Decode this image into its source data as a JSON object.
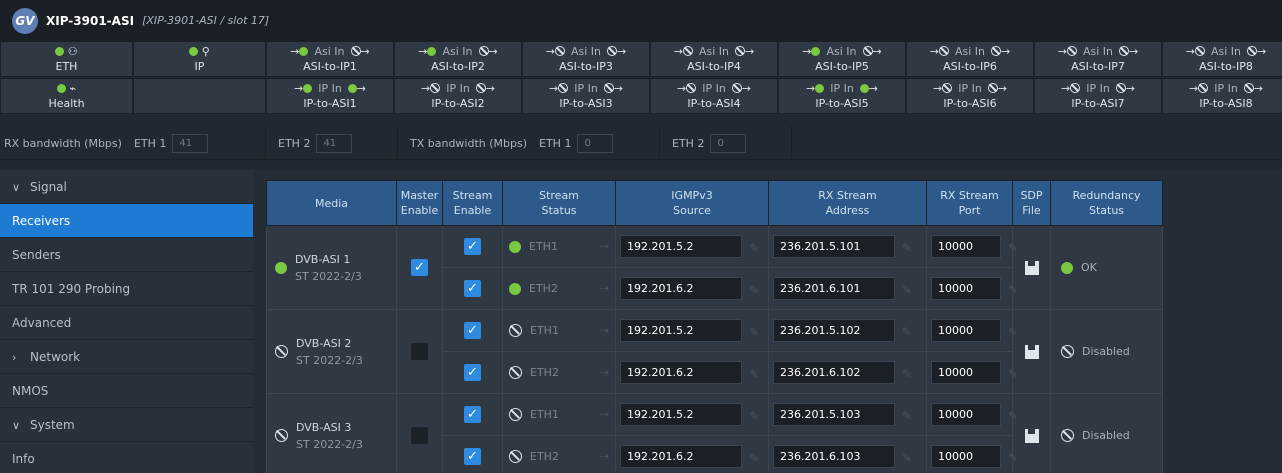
{
  "window": {
    "title": "XIP-3901-ASI",
    "subtitle": "[XIP-3901-ASI / slot 17]",
    "logo": "GV"
  },
  "status_row1": [
    {
      "label": "ETH",
      "kind": "eth"
    },
    {
      "label": "IP",
      "kind": "ip"
    },
    {
      "label": "ASI-to-IP1",
      "mode": "Asi In",
      "state": "ok"
    },
    {
      "label": "ASI-to-IP2",
      "mode": "Asi In",
      "state": "ok"
    },
    {
      "label": "ASI-to-IP3",
      "mode": "Asi In",
      "state": "off"
    },
    {
      "label": "ASI-to-IP4",
      "mode": "Asi In",
      "state": "off"
    },
    {
      "label": "ASI-to-IP5",
      "mode": "Asi In",
      "state": "ok"
    },
    {
      "label": "ASI-to-IP6",
      "mode": "Asi In",
      "state": "off"
    },
    {
      "label": "ASI-to-IP7",
      "mode": "Asi In",
      "state": "off"
    },
    {
      "label": "ASI-to-IP8",
      "mode": "Asi In",
      "state": "off"
    }
  ],
  "status_row2": [
    {
      "label": "Health",
      "kind": "health"
    },
    {
      "label": "",
      "kind": "empty"
    },
    {
      "label": "IP-to-ASI1",
      "mode": "IP In",
      "state": "ok"
    },
    {
      "label": "IP-to-ASI2",
      "mode": "IP In",
      "state": "off"
    },
    {
      "label": "IP-to-ASI3",
      "mode": "IP In",
      "state": "off"
    },
    {
      "label": "IP-to-ASI4",
      "mode": "IP In",
      "state": "off"
    },
    {
      "label": "IP-to-ASI5",
      "mode": "IP In",
      "state": "ok"
    },
    {
      "label": "IP-to-ASI6",
      "mode": "IP In",
      "state": "off"
    },
    {
      "label": "IP-to-ASI7",
      "mode": "IP In",
      "state": "off"
    },
    {
      "label": "IP-to-ASI8",
      "mode": "IP In",
      "state": "off"
    }
  ],
  "bandwidth": {
    "rx_label": "RX bandwidth (Mbps)",
    "rx_eth1_label": "ETH 1",
    "rx_eth1": "41",
    "rx_eth2_label": "ETH 2",
    "rx_eth2": "41",
    "tx_label": "TX bandwidth (Mbps)",
    "tx_eth1_label": "ETH 1",
    "tx_eth1": "0",
    "tx_eth2_label": "ETH 2",
    "tx_eth2": "0"
  },
  "sidebar": [
    {
      "label": "Signal",
      "chev": "∨"
    },
    {
      "label": "Receivers",
      "chev": ""
    },
    {
      "label": "Senders",
      "chev": ""
    },
    {
      "label": "TR 101 290 Probing",
      "chev": ""
    },
    {
      "label": "Advanced",
      "chev": ""
    },
    {
      "label": "Network",
      "chev": "›"
    },
    {
      "label": "NMOS",
      "chev": ""
    },
    {
      "label": "System",
      "chev": "∨"
    },
    {
      "label": "Info",
      "chev": ""
    }
  ],
  "table_headers": [
    "Media",
    "Master\nEnable",
    "Stream\nEnable",
    "Stream\nStatus",
    "IGMPv3\nSource",
    "RX Stream\nAddress",
    "RX Stream\nPort",
    "SDP\nFile",
    "Redundancy\nStatus"
  ],
  "receivers": [
    {
      "name": "DVB-ASI 1",
      "std": "ST 2022-2/3",
      "ok": true,
      "master": true,
      "redundancy": "OK",
      "streams": [
        {
          "enable": true,
          "status": "ETH1",
          "ok": true,
          "src": "192.201.5.2",
          "addr": "236.201.5.101",
          "port": "10000"
        },
        {
          "enable": true,
          "status": "ETH2",
          "ok": true,
          "src": "192.201.6.2",
          "addr": "236.201.6.101",
          "port": "10000"
        }
      ]
    },
    {
      "name": "DVB-ASI 2",
      "std": "ST 2022-2/3",
      "ok": false,
      "master": false,
      "redundancy": "Disabled",
      "streams": [
        {
          "enable": true,
          "status": "ETH1",
          "ok": false,
          "src": "192.201.5.2",
          "addr": "236.201.5.102",
          "port": "10000"
        },
        {
          "enable": true,
          "status": "ETH2",
          "ok": false,
          "src": "192.201.6.2",
          "addr": "236.201.6.102",
          "port": "10000"
        }
      ]
    },
    {
      "name": "DVB-ASI 3",
      "std": "ST 2022-2/3",
      "ok": false,
      "master": false,
      "redundancy": "Disabled",
      "streams": [
        {
          "enable": true,
          "status": "ETH1",
          "ok": false,
          "src": "192.201.5.2",
          "addr": "236.201.5.103",
          "port": "10000"
        },
        {
          "enable": true,
          "status": "ETH2",
          "ok": false,
          "src": "192.201.6.2",
          "addr": "236.201.6.103",
          "port": "10000"
        }
      ]
    }
  ],
  "colors": {
    "accent": "#1e7bd4",
    "ok": "#7ac943",
    "header": "#2d5a8a"
  }
}
